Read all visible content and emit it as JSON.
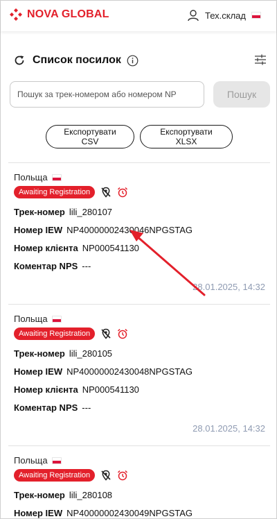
{
  "brand": {
    "name": "NOVA GLOBAL",
    "accent": "#e3202b"
  },
  "user": {
    "label": "Тех.склад"
  },
  "page": {
    "title": "Список посилок"
  },
  "search": {
    "placeholder": "Пошук за трек-номером або номером NP",
    "button_label": "Пошук"
  },
  "export": {
    "csv_label": "Експортувати CSV",
    "xlsx_label": "Експортувати XLSX"
  },
  "labels": {
    "track": "Трек-номер",
    "iew": "Номер IEW",
    "client": "Номер клієнта",
    "comment": "Коментар NPS"
  },
  "parcels": [
    {
      "country": "Польща",
      "status": "Awaiting Registration",
      "track": "lili_280107",
      "iew": "NP40000002430046NPGSTAG",
      "client": "NP000541130",
      "comment": "---",
      "date": "28.01.2025, 14:32"
    },
    {
      "country": "Польща",
      "status": "Awaiting Registration",
      "track": "lili_280105",
      "iew": "NP40000002430048NPGSTAG",
      "client": "NP000541130",
      "comment": "---",
      "date": "28.01.2025, 14:32"
    },
    {
      "country": "Польща",
      "status": "Awaiting Registration",
      "track": "lili_280108",
      "iew": "NP40000002430049NPGSTAG"
    }
  ]
}
